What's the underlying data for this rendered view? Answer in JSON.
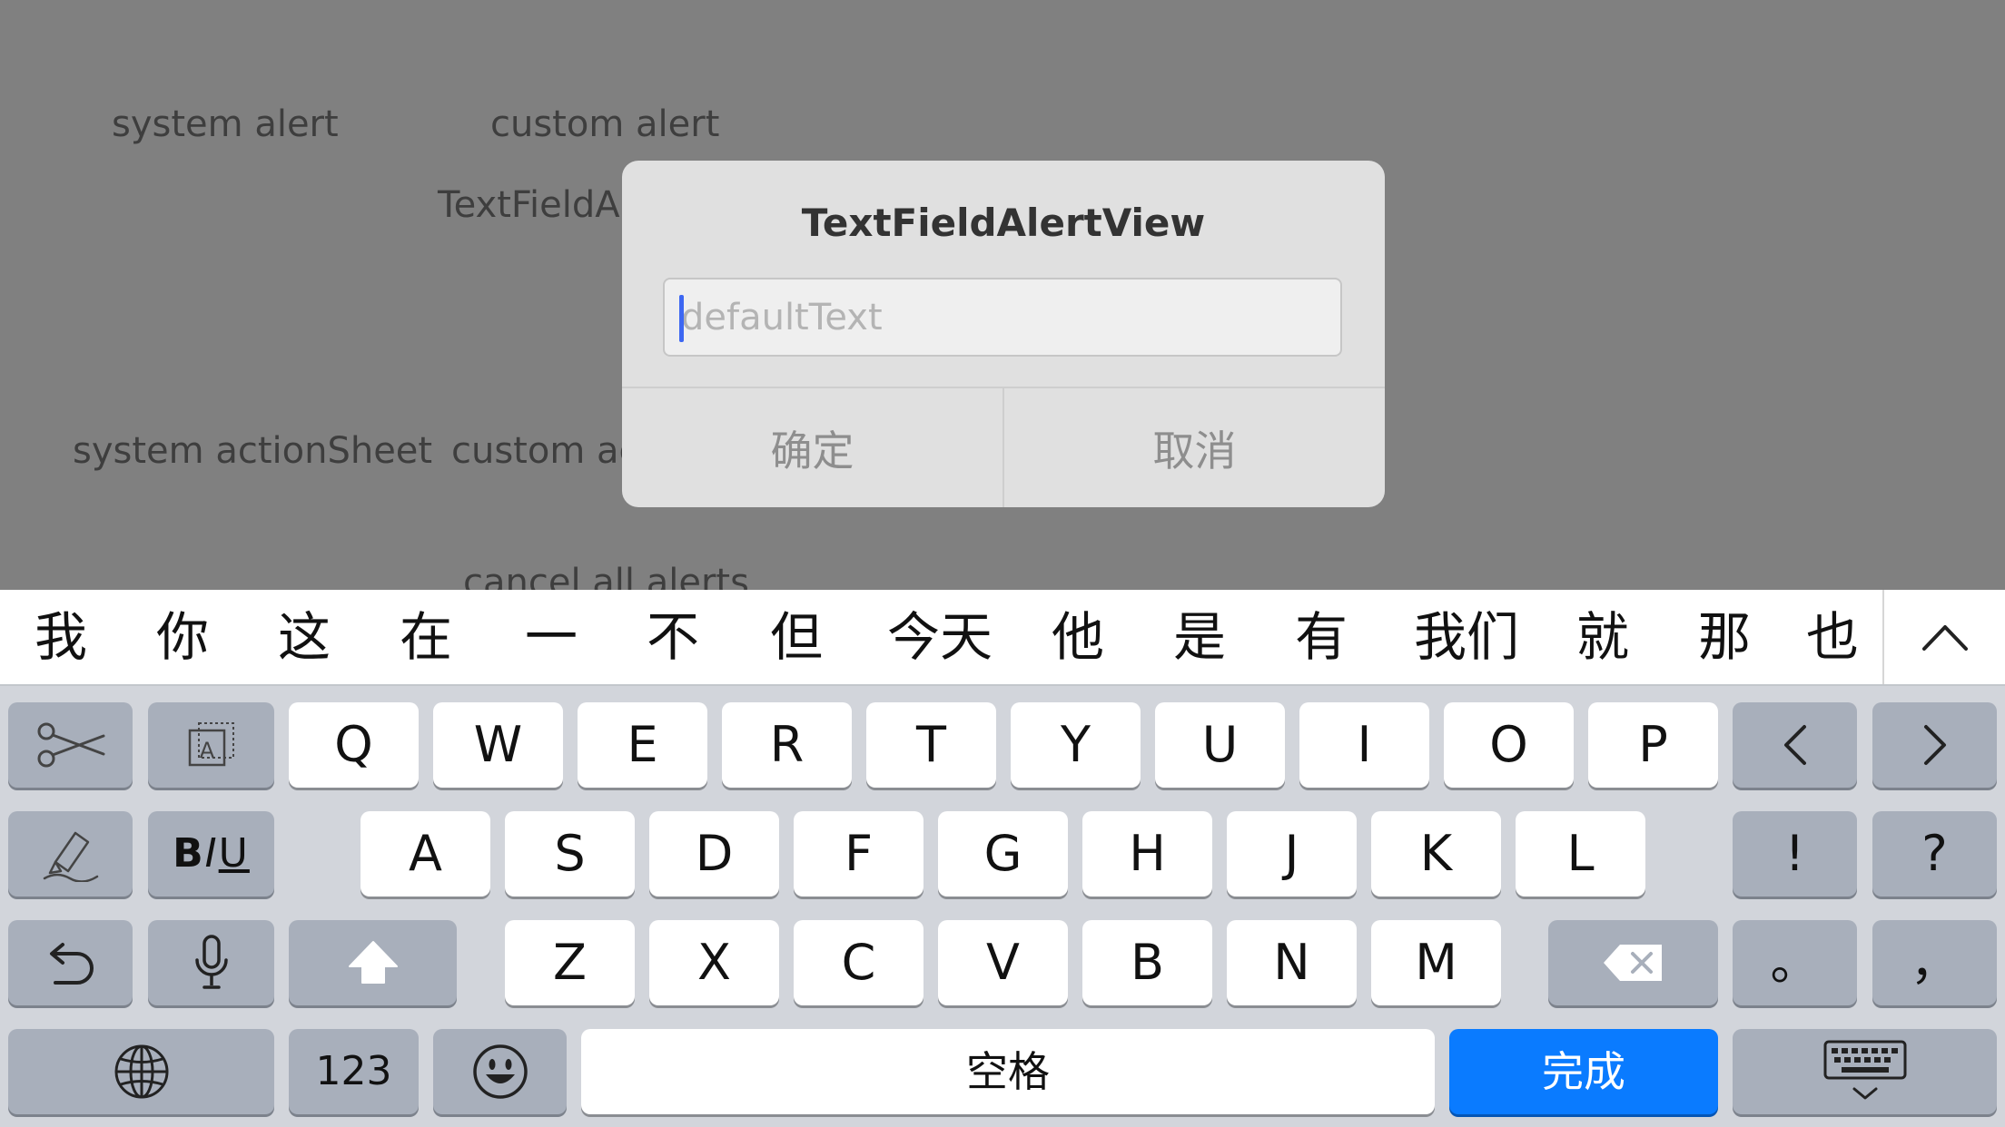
{
  "app": {
    "buttons": {
      "system_alert": "system alert",
      "custom_alert": "custom alert",
      "textfield_alert_partial": "TextFieldA",
      "system_action_sheet": "system actionSheet",
      "custom_action_sheet_partial": "custom ac",
      "cancel_all_alerts": "cancel all alerts"
    }
  },
  "alert": {
    "title": "TextFieldAlertView",
    "field_placeholder": "defaultText",
    "field_value": "",
    "confirm_label": "确定",
    "cancel_label": "取消"
  },
  "candidates": {
    "items": [
      "我",
      "你",
      "这",
      "在",
      "一",
      "不",
      "但",
      "今天",
      "他",
      "是",
      "有",
      "我们",
      "就",
      "那",
      "也"
    ],
    "expand_icon": "chevron-up-icon"
  },
  "keyboard": {
    "row1": [
      "Q",
      "W",
      "E",
      "R",
      "T",
      "Y",
      "U",
      "I",
      "O",
      "P"
    ],
    "row2": [
      "A",
      "S",
      "D",
      "F",
      "G",
      "H",
      "J",
      "K",
      "L"
    ],
    "row3": [
      "Z",
      "X",
      "C",
      "V",
      "B",
      "N",
      "M"
    ],
    "punct_row2": [
      "!",
      "?"
    ],
    "punct_row3": [
      "。",
      "，"
    ],
    "num_label": "123",
    "space_label": "空格",
    "done_label": "完成",
    "biu_b": "B",
    "biu_i": "I",
    "biu_u": "U",
    "colors": {
      "done_key": "#0a7bff",
      "caret": "#3d67f2"
    }
  }
}
